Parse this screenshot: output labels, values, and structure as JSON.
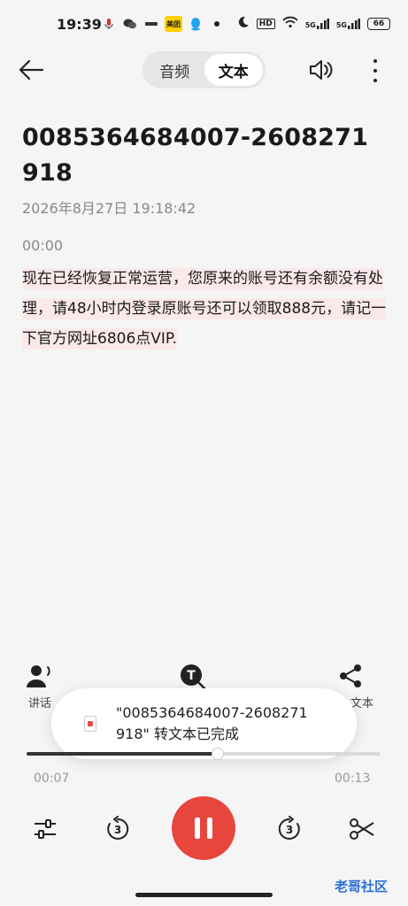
{
  "status_bar": {
    "time": "19:39",
    "left_icons": [
      "voice-icon",
      "wechat-icon",
      "app-icon",
      "meituan-icon",
      "qq-icon",
      "dot-icon"
    ],
    "meituan_label": "美团",
    "hd_label": "HD",
    "signal_label": "5G",
    "battery": "66"
  },
  "header": {
    "tabs": [
      {
        "label": "音频",
        "active": false
      },
      {
        "label": "文本",
        "active": true
      }
    ]
  },
  "recording": {
    "title": "0085364684007-2608271918",
    "datetime": "2026年8月27日 19:18:42",
    "segment_time": "00:00",
    "transcript": "现在已经恢复正常运营，您原来的账号还有余额没有处理，请48小时内登录原账号还可以领取888元，请记一下官方网址6806点VIP."
  },
  "tools": {
    "speaker_label": "讲话",
    "share_label": "文本"
  },
  "toast": {
    "message": "\"0085364684007-2608271918\" 转文本已完成"
  },
  "player": {
    "current_time": "00:07",
    "total_time": "00:13",
    "progress_fraction": 0.54,
    "rewind_seconds": "3",
    "forward_seconds": "3"
  },
  "watermark": "老哥社区",
  "colors": {
    "accent": "#e8453c",
    "highlight": "#fbe9ea"
  }
}
